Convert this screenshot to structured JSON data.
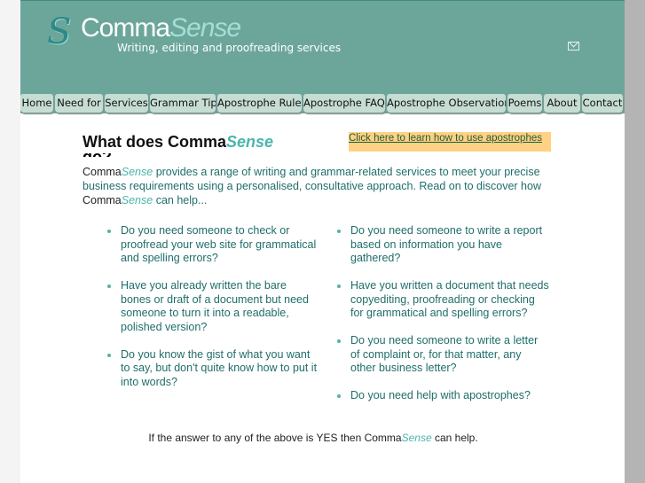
{
  "brand": {
    "logo_s": "S",
    "name_a": "Comma",
    "name_b": "Sense",
    "tagline": "Writing, editing and proofreading services"
  },
  "nav": [
    "Home",
    "Need for",
    "Services",
    "Grammar Tips",
    "Apostrophe Rules",
    "Apostrophe FAQs",
    "Apostrophe Observations",
    "Poems",
    "About",
    "Contact"
  ],
  "heading": {
    "a": "What does Comma",
    "b": "Sense",
    "c": "do?"
  },
  "promo_link": "Click here to learn how to use apostrophes",
  "intro": {
    "a": "Comma",
    "b": "Sense",
    "c": " provides a range of writing and grammar-related services to meet your precise business requirements using a personalised, consultative approach. Read on to discover how ",
    "d": "Comma",
    "e": "Sense",
    "f": " can help..."
  },
  "left_items": [
    "Do you need someone to check or proofread your web site for grammatical and spelling errors?",
    "Have you already written the bare bones or draft of a document but need someone to turn it into a readable, polished version?",
    "Do you know the gist of what you want to say, but don't quite know how to put it into words?"
  ],
  "right_items": [
    "Do you need someone to write a report based on information you have gathered?",
    "Have you written a document that needs copyediting, proofreading or checking for grammatical and spelling errors?",
    "Do you need someone to write a letter of complaint or, for that matter, any other business letter?",
    "Do you need help with apostrophes?"
  ],
  "footer": {
    "a": "If the answer to any of the above is YES then Comma",
    "b": "Sense",
    "c": " can help."
  },
  "colors": {
    "header": "#6ca69b",
    "tab": "#c6ddd3",
    "promo": "#ffd182",
    "text": "#1f6e6a",
    "accent": "#4ab5aa"
  }
}
